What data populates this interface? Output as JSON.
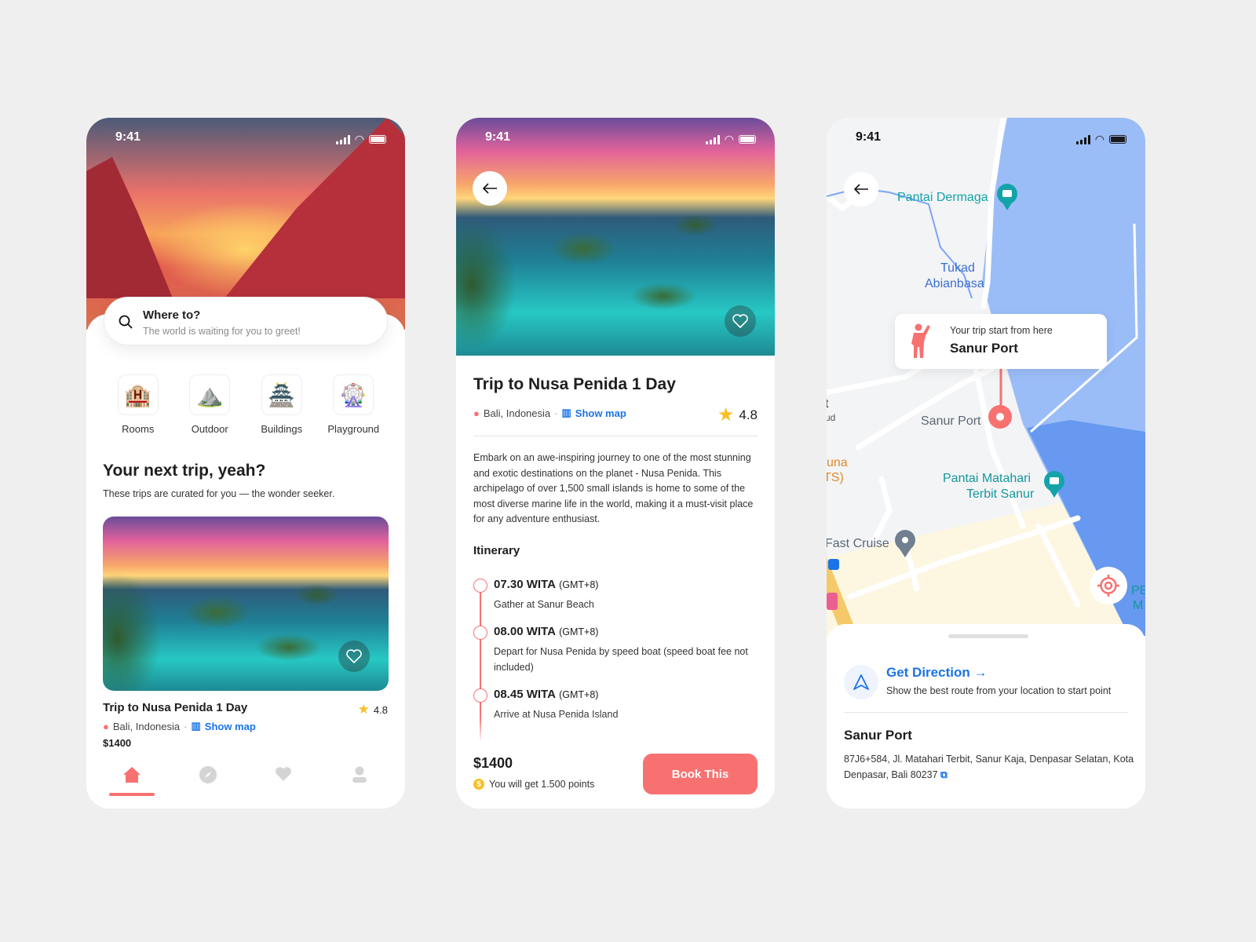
{
  "status": {
    "time": "9:41"
  },
  "home": {
    "search": {
      "title": "Where to?",
      "placeholder": "The world is waiting for you to greet!"
    },
    "categories": [
      {
        "label": "Rooms",
        "icon": "hotel-building-icon"
      },
      {
        "label": "Outdoor",
        "icon": "mountain-icon"
      },
      {
        "label": "Buildings",
        "icon": "pagoda-icon"
      },
      {
        "label": "Playground",
        "icon": "ferris-wheel-icon"
      }
    ],
    "section_title": "Your next trip, yeah?",
    "section_subtitle": "These trips are curated for you — the wonder seeker.",
    "card": {
      "title": "Trip to Nusa Penida 1 Day",
      "rating": "4.8",
      "location": "Bali, Indonesia",
      "show_map": "Show map",
      "price": "$1400"
    },
    "nav": [
      {
        "icon": "home-icon",
        "active": true
      },
      {
        "icon": "compass-icon"
      },
      {
        "icon": "heart-icon"
      },
      {
        "icon": "profile-icon"
      }
    ]
  },
  "detail": {
    "title": "Trip to Nusa Penida 1 Day",
    "location": "Bali, Indonesia",
    "show_map": "Show map",
    "rating": "4.8",
    "description": "Embark on an awe-inspiring journey to one of the most stunning and exotic destinations on the planet - Nusa Penida. This archipelago of over 1,500 small islands is home to some of the most diverse marine life in the world, making it a must-visit place for any adventure enthusiast.",
    "itinerary_title": "Itinerary",
    "itinerary": [
      {
        "time": "07.30 WITA",
        "tz": "(GMT+8)",
        "desc": "Gather at Sanur Beach"
      },
      {
        "time": "08.00 WITA",
        "tz": "(GMT+8)",
        "desc": "Depart for Nusa Penida by speed boat (speed boat fee not included)"
      },
      {
        "time": "08.45 WITA",
        "tz": "(GMT+8)",
        "desc": "Arrive at Nusa Penida Island"
      }
    ],
    "price": "$1400",
    "points": "You will get 1.500 points",
    "book_label": "Book This"
  },
  "map": {
    "labels": {
      "pantai_dermaga": "Pantai Dermaga",
      "tukad": "Tukad",
      "abianbasa": "Abianbasa",
      "sanur_port": "Sanur Port",
      "pantai_matahari_1": "Pantai Matahari",
      "pantai_matahari_2": "Terbit Sanur",
      "fast_cruise": "Fast Cruise",
      "partial_t": "t",
      "partial_ud": "ud",
      "partial_una": "una",
      "partial_ts": "TS)",
      "partial_pe": "PE",
      "partial_m": "M"
    },
    "tooltip": {
      "caption": "Your trip start from here",
      "place": "Sanur Port"
    },
    "direction": {
      "title": "Get Direction",
      "subtitle": "Show the best route from your location to start point"
    },
    "place": {
      "name": "Sanur Port",
      "address": "87J6+584, Jl. Matahari Terbit, Sanur Kaja, Denpasar Selatan, Kota Denpasar, Bali 80237"
    }
  },
  "colors": {
    "accent": "#f87171",
    "link": "#1a73e8",
    "star": "#fbbf24",
    "ocean": "#9bbdf7",
    "poi": "#14a3a8"
  }
}
